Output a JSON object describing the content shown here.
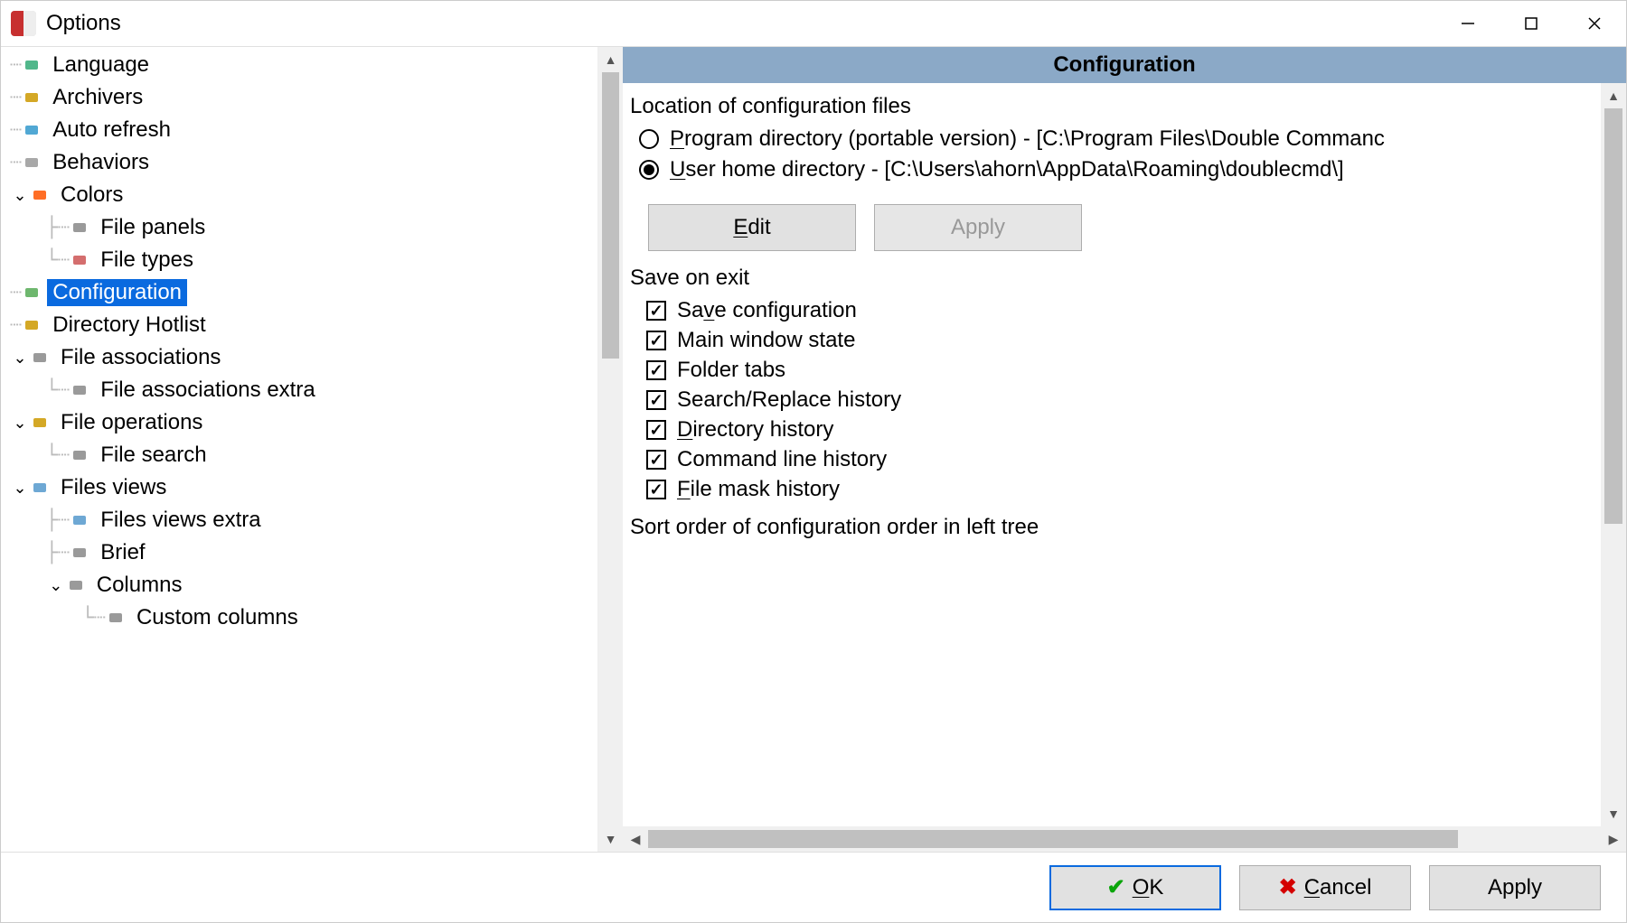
{
  "window": {
    "title": "Options"
  },
  "tree": [
    {
      "label": "Language",
      "depth": 0,
      "expandable": false,
      "selected": false,
      "icon": "language-icon"
    },
    {
      "label": "Archivers",
      "depth": 0,
      "expandable": false,
      "selected": false,
      "icon": "archivers-icon"
    },
    {
      "label": "Auto refresh",
      "depth": 0,
      "expandable": false,
      "selected": false,
      "icon": "refresh-icon"
    },
    {
      "label": "Behaviors",
      "depth": 0,
      "expandable": false,
      "selected": false,
      "icon": "behaviors-icon"
    },
    {
      "label": "Colors",
      "depth": 0,
      "expandable": true,
      "selected": false,
      "icon": "colors-icon"
    },
    {
      "label": "File panels",
      "depth": 1,
      "expandable": false,
      "selected": false,
      "icon": "panels-icon"
    },
    {
      "label": "File types",
      "depth": 1,
      "expandable": false,
      "selected": false,
      "icon": "types-icon",
      "last": true
    },
    {
      "label": "Configuration",
      "depth": 0,
      "expandable": false,
      "selected": true,
      "icon": "config-icon"
    },
    {
      "label": "Directory Hotlist",
      "depth": 0,
      "expandable": false,
      "selected": false,
      "icon": "hotlist-icon"
    },
    {
      "label": "File associations",
      "depth": 0,
      "expandable": true,
      "selected": false,
      "icon": "assoc-icon"
    },
    {
      "label": "File associations extra",
      "depth": 1,
      "expandable": false,
      "selected": false,
      "icon": "assoc-extra-icon",
      "last": true
    },
    {
      "label": "File operations",
      "depth": 0,
      "expandable": true,
      "selected": false,
      "icon": "fileops-icon"
    },
    {
      "label": "File search",
      "depth": 1,
      "expandable": false,
      "selected": false,
      "icon": "search-icon",
      "last": true
    },
    {
      "label": "Files views",
      "depth": 0,
      "expandable": true,
      "selected": false,
      "icon": "views-icon"
    },
    {
      "label": "Files views extra",
      "depth": 1,
      "expandable": false,
      "selected": false,
      "icon": "views-extra-icon"
    },
    {
      "label": "Brief",
      "depth": 1,
      "expandable": false,
      "selected": false,
      "icon": "brief-icon"
    },
    {
      "label": "Columns",
      "depth": 1,
      "expandable": true,
      "selected": false,
      "icon": "columns-icon"
    },
    {
      "label": "Custom columns",
      "depth": 2,
      "expandable": false,
      "selected": false,
      "icon": "custom-cols-icon",
      "last": true
    }
  ],
  "content": {
    "header": "Configuration",
    "locationLabel": "Location of configuration files",
    "radios": [
      {
        "label": "Program directory (portable version) - [C:\\Program Files\\Double Commanc",
        "checked": false,
        "accel": "P"
      },
      {
        "label": "User home directory - [C:\\Users\\ahorn\\AppData\\Roaming\\doublecmd\\]",
        "checked": true,
        "accel": "U"
      }
    ],
    "editButton": "Edit",
    "applyButton": "Apply",
    "applyDisabled": true,
    "saveOnExitLabel": "Save on exit",
    "checks": [
      {
        "label": "Save configuration",
        "checked": true,
        "accel": "v"
      },
      {
        "label": "Main window state",
        "checked": true,
        "accel": null
      },
      {
        "label": "Folder tabs",
        "checked": true,
        "accel": null
      },
      {
        "label": "Search/Replace history",
        "checked": true,
        "accel": null
      },
      {
        "label": "Directory history",
        "checked": true,
        "accel": "D"
      },
      {
        "label": "Command line history",
        "checked": true,
        "accel": null
      },
      {
        "label": "File mask history",
        "checked": true,
        "accel": "F"
      }
    ],
    "sortOrderLabel": "Sort order of configuration order in left tree"
  },
  "footer": {
    "ok": "OK",
    "cancel": "Cancel",
    "apply": "Apply"
  }
}
